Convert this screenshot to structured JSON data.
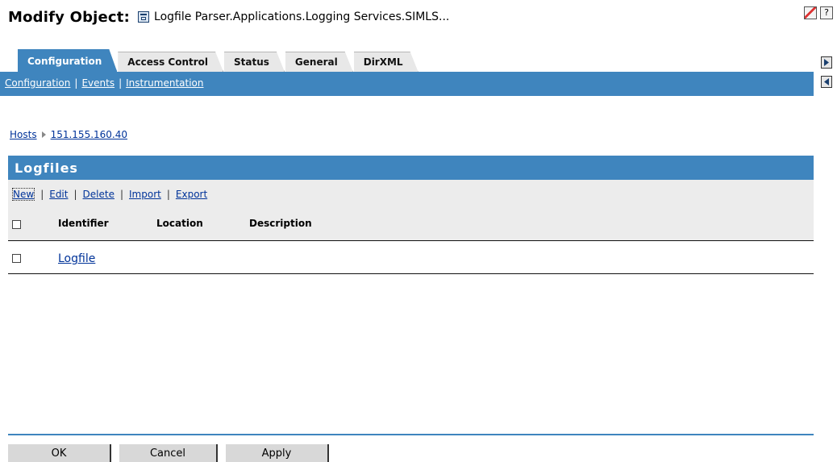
{
  "header": {
    "title": "Modify Object:",
    "object_name": "Logfile Parser.Applications.Logging Services.SIMLS...",
    "help_glyph": "?"
  },
  "tabs": [
    {
      "label": "Configuration",
      "active": true
    },
    {
      "label": "Access Control",
      "active": false
    },
    {
      "label": "Status",
      "active": false
    },
    {
      "label": "General",
      "active": false
    },
    {
      "label": "DirXML",
      "active": false
    }
  ],
  "subnav": [
    "Configuration",
    "Events",
    "Instrumentation"
  ],
  "breadcrumb": [
    "Hosts",
    "151.155.160.40"
  ],
  "panel": {
    "title": "Logfiles",
    "actions": [
      "New",
      "Edit",
      "Delete",
      "Import",
      "Export"
    ],
    "columns": [
      "Identifier",
      "Location",
      "Description"
    ],
    "rows": [
      {
        "identifier": "Logfile",
        "location": "",
        "description": ""
      }
    ]
  },
  "footer": {
    "ok": "OK",
    "cancel": "Cancel",
    "apply": "Apply"
  },
  "colors": {
    "accent": "#3f85be",
    "link": "#003399",
    "toolbar_bg": "#ececec"
  },
  "icons": [
    "task-icon",
    "help-icon",
    "scroll-right-icon",
    "scroll-left-icon",
    "object-icon",
    "breadcrumb-arrow-icon"
  ]
}
